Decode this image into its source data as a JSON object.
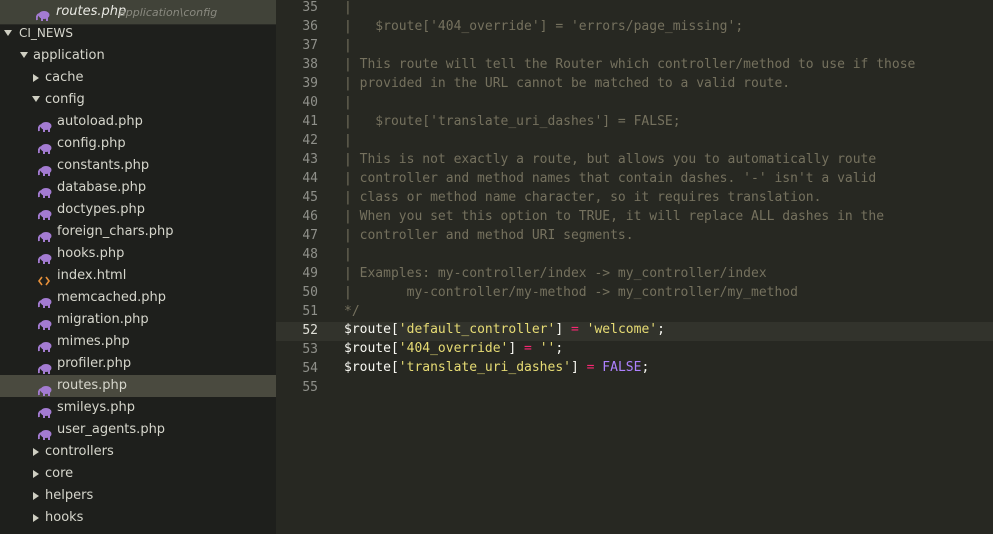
{
  "window": {
    "title": "routes.php"
  },
  "open_file": {
    "name": "routes.php",
    "path": "application\\config"
  },
  "sidebar": {
    "root": "CI_NEWS",
    "items": [
      {
        "label": "application",
        "type": "folder",
        "expanded": true,
        "depth": 1
      },
      {
        "label": "cache",
        "type": "folder",
        "expanded": false,
        "depth": 2
      },
      {
        "label": "config",
        "type": "folder",
        "expanded": true,
        "depth": 2
      },
      {
        "label": "autoload.php",
        "type": "php",
        "depth": 3
      },
      {
        "label": "config.php",
        "type": "php",
        "depth": 3
      },
      {
        "label": "constants.php",
        "type": "php",
        "depth": 3
      },
      {
        "label": "database.php",
        "type": "php",
        "depth": 3
      },
      {
        "label": "doctypes.php",
        "type": "php",
        "depth": 3
      },
      {
        "label": "foreign_chars.php",
        "type": "php",
        "depth": 3
      },
      {
        "label": "hooks.php",
        "type": "php",
        "depth": 3
      },
      {
        "label": "index.html",
        "type": "html",
        "depth": 3
      },
      {
        "label": "memcached.php",
        "type": "php",
        "depth": 3
      },
      {
        "label": "migration.php",
        "type": "php",
        "depth": 3
      },
      {
        "label": "mimes.php",
        "type": "php",
        "depth": 3
      },
      {
        "label": "profiler.php",
        "type": "php",
        "depth": 3
      },
      {
        "label": "routes.php",
        "type": "php",
        "depth": 3,
        "selected": true
      },
      {
        "label": "smileys.php",
        "type": "php",
        "depth": 3
      },
      {
        "label": "user_agents.php",
        "type": "php",
        "depth": 3
      },
      {
        "label": "controllers",
        "type": "folder",
        "expanded": false,
        "depth": 2
      },
      {
        "label": "core",
        "type": "folder",
        "expanded": false,
        "depth": 2
      },
      {
        "label": "helpers",
        "type": "folder",
        "expanded": false,
        "depth": 2
      },
      {
        "label": "hooks",
        "type": "folder",
        "expanded": false,
        "depth": 2
      }
    ]
  },
  "editor": {
    "highlighted_line": 52,
    "lines": [
      {
        "n": "35",
        "t": "|"
      },
      {
        "n": "36",
        "t": "|   $route['404_override'] = 'errors/page_missing';"
      },
      {
        "n": "37",
        "t": "|"
      },
      {
        "n": "38",
        "t": "| This route will tell the Router which controller/method to use if those"
      },
      {
        "n": "39",
        "t": "| provided in the URL cannot be matched to a valid route."
      },
      {
        "n": "40",
        "t": "|"
      },
      {
        "n": "41",
        "t": "|   $route['translate_uri_dashes'] = FALSE;"
      },
      {
        "n": "42",
        "t": "|"
      },
      {
        "n": "43",
        "t": "| This is not exactly a route, but allows you to automatically route"
      },
      {
        "n": "44",
        "t": "| controller and method names that contain dashes. '-' isn't a valid"
      },
      {
        "n": "45",
        "t": "| class or method name character, so it requires translation."
      },
      {
        "n": "46",
        "t": "| When you set this option to TRUE, it will replace ALL dashes in the"
      },
      {
        "n": "47",
        "t": "| controller and method URI segments."
      },
      {
        "n": "48",
        "t": "|"
      },
      {
        "n": "49",
        "t": "| Examples: my-controller/index -> my_controller/index"
      },
      {
        "n": "50",
        "t": "|       my-controller/my-method -> my_controller/my_method"
      },
      {
        "n": "51",
        "t": "*/"
      },
      {
        "n": "52",
        "t": ""
      },
      {
        "n": "53",
        "t": ""
      },
      {
        "n": "54",
        "t": ""
      },
      {
        "n": "55",
        "t": ""
      }
    ],
    "code": {
      "l52": {
        "var": "$route",
        "open": "[",
        "key": "'default_controller'",
        "close": "]",
        "eq": "=",
        "val": "'welcome'",
        "end": ";"
      },
      "l53": {
        "var": "$route",
        "open": "[",
        "key": "'404_override'",
        "close": "]",
        "eq": "=",
        "val": "''",
        "end": ";"
      },
      "l54": {
        "var": "$route",
        "open": "[",
        "key": "'translate_uri_dashes'",
        "close": "]",
        "eq": "=",
        "val": "FALSE",
        "end": ";"
      }
    }
  },
  "colors": {
    "sidebar_bg": "#1e1f1c",
    "editor_bg": "#272822",
    "selection": "#4a4a3f",
    "comment": "#75715e",
    "string": "#e6db74",
    "operator": "#f92672",
    "constant": "#ae81ff"
  },
  "icons": {
    "php_file": "elephant-icon",
    "html_file": "code-brackets-icon",
    "folder_open": "chevron-down-icon",
    "folder_closed": "chevron-right-icon"
  }
}
